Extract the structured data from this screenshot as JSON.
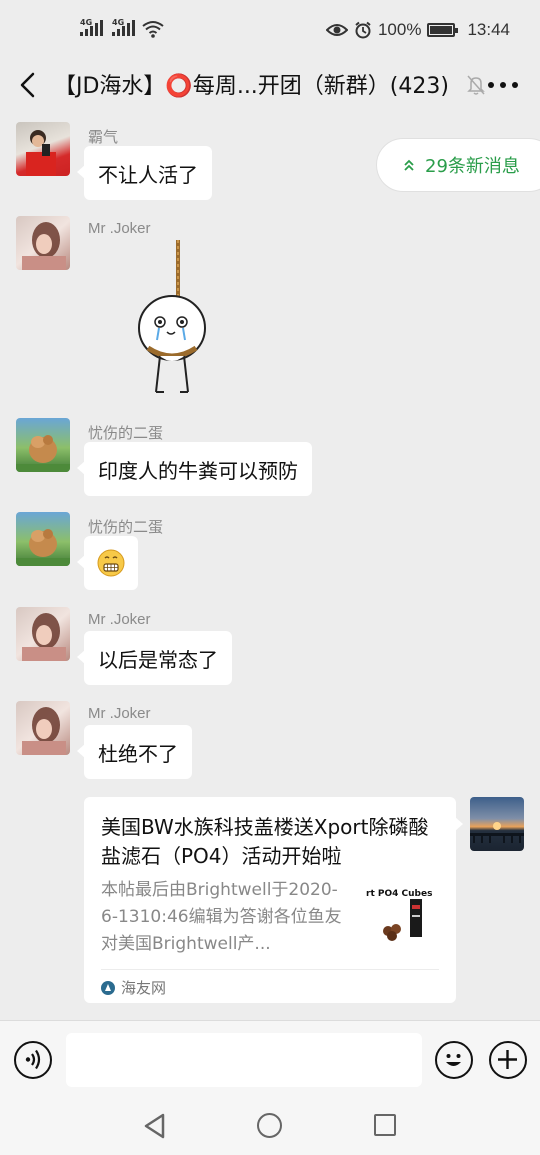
{
  "status_bar": {
    "signal1_label": "4G",
    "signal2_label": "4G",
    "battery_percent": "100%",
    "time": "13:44"
  },
  "header": {
    "title": "【JD海水】⭕每周...开团（新群）(423)"
  },
  "new_messages": {
    "label": "29条新消息"
  },
  "messages": [
    {
      "sender": "霸气",
      "text": "不让人活了"
    },
    {
      "sender": "Mr .Joker",
      "text": ""
    },
    {
      "sender": "忧伤的二蛋",
      "text": "印度人的牛粪可以预防"
    },
    {
      "sender": "忧伤的二蛋",
      "text": ""
    },
    {
      "sender": "Mr .Joker",
      "text": "以后是常态了"
    },
    {
      "sender": "Mr .Joker",
      "text": "杜绝不了"
    }
  ],
  "link_card": {
    "title": "美国BW水族科技盖楼送Xport除磷酸盐滤石（PO4）活动开始啦",
    "description": "本帖最后由Brightwell于2020-6-1310:46编辑为答谢各位鱼友对美国Brightwell产...",
    "thumb_text": "rt PO4 Cubes",
    "source": "海友网"
  },
  "input": {
    "placeholder": ""
  },
  "icons": {
    "back": "back-arrow-icon",
    "mute": "mute-bell-icon",
    "more": "more-dots-icon",
    "voice": "voice-icon",
    "emoji": "emoji-icon",
    "plus": "plus-icon"
  },
  "colors": {
    "background": "#ededed",
    "bubble": "#ffffff",
    "new_messages_text": "#2a9d4a"
  }
}
